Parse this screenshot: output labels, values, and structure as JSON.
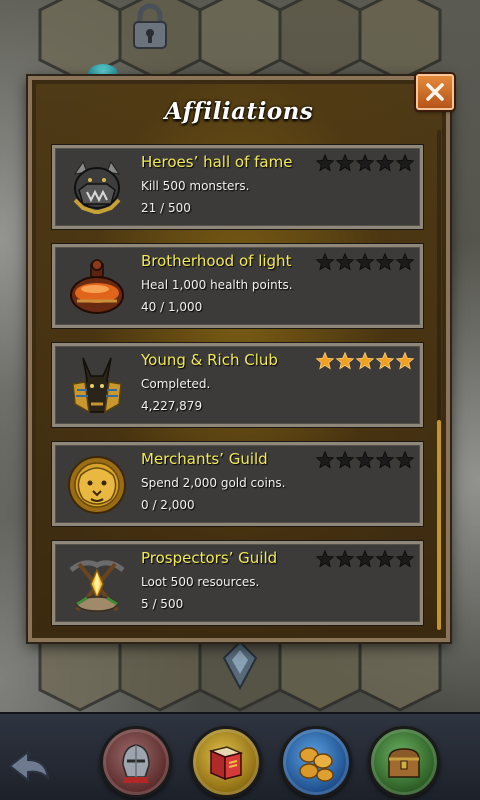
{
  "panel": {
    "title": "Affiliations",
    "close_label": "close"
  },
  "affiliations": [
    {
      "name": "Heroes’ hall of fame",
      "description": "Kill 500 monsters.",
      "progress": "21 / 500",
      "stars_earned": 0,
      "stars_total": 5,
      "icon": "helmet-icon"
    },
    {
      "name": "Brotherhood of light",
      "description": "Heal 1,000 health points.",
      "progress": "40 / 1,000",
      "stars_earned": 0,
      "stars_total": 5,
      "icon": "potion-icon"
    },
    {
      "name": "Young & Rich Club",
      "description": "Completed.",
      "progress": "4,227,879",
      "stars_earned": 5,
      "stars_total": 5,
      "icon": "anubis-mask-icon"
    },
    {
      "name": "Merchants’ Guild",
      "description": "Spend 2,000 gold coins.",
      "progress": "0 / 2,000",
      "stars_earned": 0,
      "stars_total": 5,
      "icon": "lion-head-icon"
    },
    {
      "name": "Prospectors’ Guild",
      "description": "Loot 500 resources.",
      "progress": "5 / 500",
      "stars_earned": 0,
      "stars_total": 5,
      "icon": "pickaxe-crystal-icon"
    }
  ],
  "colors": {
    "title_yellow": "#f2ea56",
    "star_gold": "#f0a022",
    "star_empty": "#1b1b1b",
    "close_orange": "#d86e28"
  },
  "bottom_bar": {
    "buttons": [
      {
        "icon": "back-arrow-icon"
      },
      {
        "icon": "knight-helmet-icon"
      },
      {
        "icon": "quest-book-icon"
      },
      {
        "icon": "gold-coins-icon"
      },
      {
        "icon": "treasure-chest-icon"
      }
    ]
  }
}
